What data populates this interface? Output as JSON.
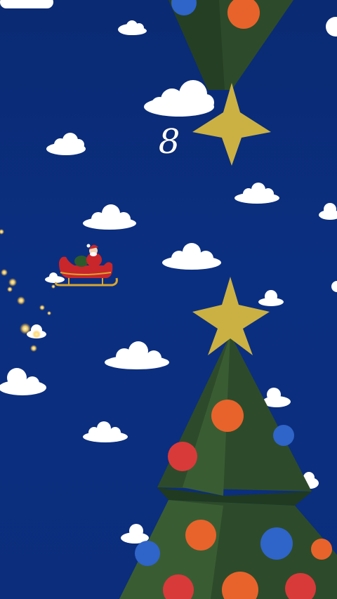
{
  "game": {
    "title": "",
    "score": "8"
  },
  "scene": {
    "background_color": "#0b2d7c",
    "cloud_color": "#ffffff",
    "tree_color": "#2d4b2a",
    "tree_shadow_color": "#1f3a21",
    "star_color": "#cbb143",
    "ornament_colors": {
      "orange": "#e8632b",
      "red": "#d83a3a",
      "blue": "#2f64c9"
    },
    "sleigh_color": "#c8262b",
    "sleigh_runner_color": "#d8a630",
    "sparkle_color": "#ffd76a"
  },
  "player": {
    "name_icon": "santa-sleigh-icon"
  },
  "obstacles": [
    {
      "name": "top-tree",
      "type": "inverted-christmas-tree"
    },
    {
      "name": "bottom-tree",
      "type": "christmas-tree"
    }
  ]
}
